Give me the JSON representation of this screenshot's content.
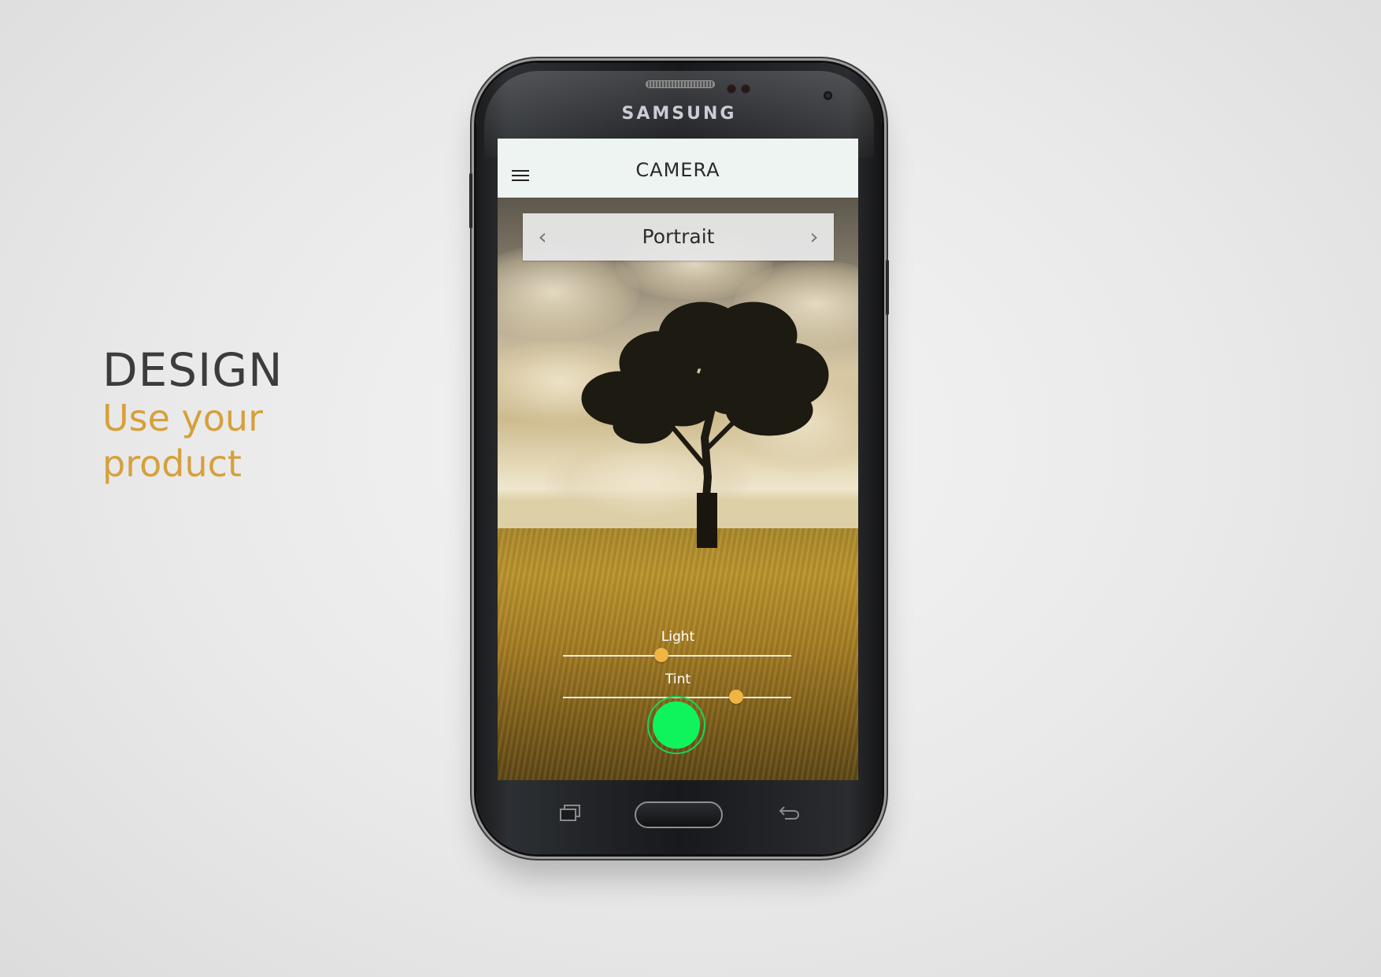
{
  "caption": {
    "headline": "DESIGN",
    "subline": "Use your product"
  },
  "phone": {
    "brand": "SAMSUNG"
  },
  "app": {
    "title": "CAMERA",
    "menu_icon": "hamburger-menu-icon",
    "mode_selector": {
      "label": "Portrait",
      "prev_icon": "chevron-left-icon",
      "next_icon": "chevron-right-icon",
      "prev_glyph": "‹",
      "next_glyph": "›"
    },
    "sliders": [
      {
        "label": "Light",
        "value": 0.43
      },
      {
        "label": "Tint",
        "value": 0.76
      }
    ],
    "shutter": {
      "color": "#0ff45d",
      "ring_color": "#16d65a"
    }
  },
  "colors": {
    "accent": "#d6a03c",
    "slider_knob": "#f1b545",
    "headline": "#3c3c3c"
  }
}
